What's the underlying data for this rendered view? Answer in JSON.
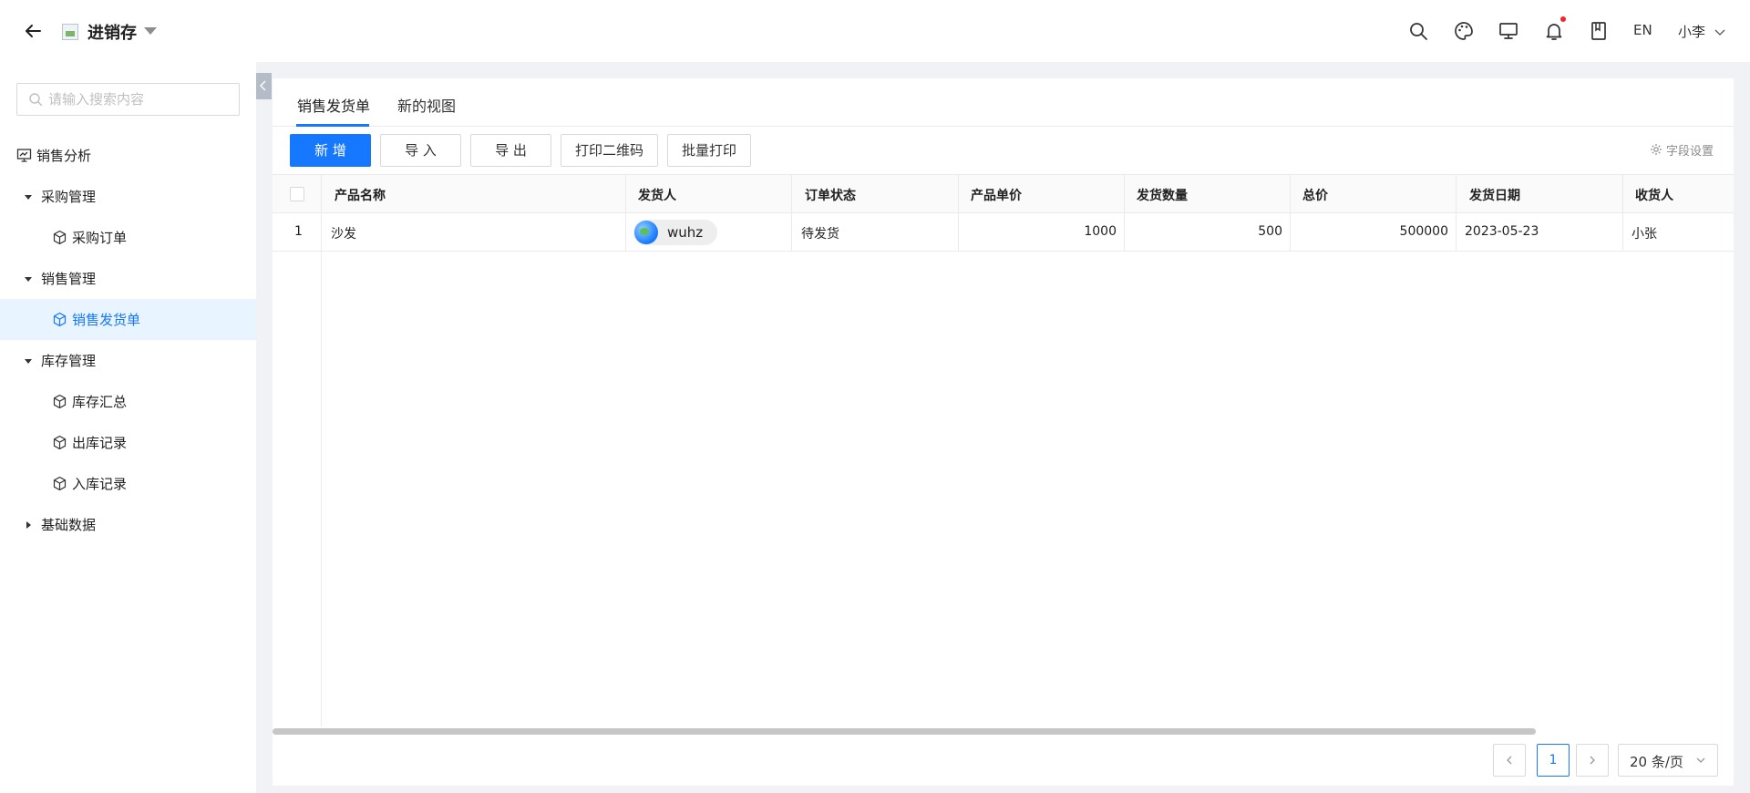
{
  "header": {
    "app_title": "进销存",
    "lang_label": "EN",
    "user_name": "小李"
  },
  "sidebar": {
    "search_placeholder": "请输入搜索内容",
    "items": [
      {
        "label": "销售分析",
        "icon": "chart-monitor-icon"
      },
      {
        "label": "采购管理",
        "expanded": true
      },
      {
        "label": "采购订单",
        "icon": "cube-icon"
      },
      {
        "label": "销售管理",
        "expanded": true
      },
      {
        "label": "销售发货单",
        "icon": "cube-icon",
        "active": true
      },
      {
        "label": "库存管理",
        "expanded": true
      },
      {
        "label": "库存汇总",
        "icon": "cube-icon"
      },
      {
        "label": "出库记录",
        "icon": "cube-icon"
      },
      {
        "label": "入库记录",
        "icon": "cube-icon"
      },
      {
        "label": "基础数据",
        "expanded": false
      }
    ]
  },
  "tabs": [
    {
      "label": "销售发货单",
      "active": true
    },
    {
      "label": "新的视图",
      "active": false
    }
  ],
  "toolbar": {
    "add_label": "新 增",
    "import_label": "导 入",
    "export_label": "导 出",
    "print_qr_label": "打印二维码",
    "batch_print_label": "批量打印",
    "field_settings_label": "字段设置"
  },
  "table": {
    "columns": [
      "产品名称",
      "发货人",
      "订单状态",
      "产品单价",
      "发货数量",
      "总价",
      "发货日期",
      "收货人"
    ],
    "rows": [
      {
        "index": "1",
        "product_name": "沙发",
        "shipper": "wuhz",
        "order_status": "待发货",
        "unit_price": "1000",
        "quantity": "500",
        "total": "500000",
        "ship_date": "2023-05-23",
        "receiver": "小张"
      }
    ]
  },
  "pagination": {
    "current_page": "1",
    "page_size_label": "20 条/页"
  },
  "colors": {
    "accent": "#1677ff",
    "notification_dot": "#f5222d",
    "active_menu_bg": "#e8f4ff"
  }
}
